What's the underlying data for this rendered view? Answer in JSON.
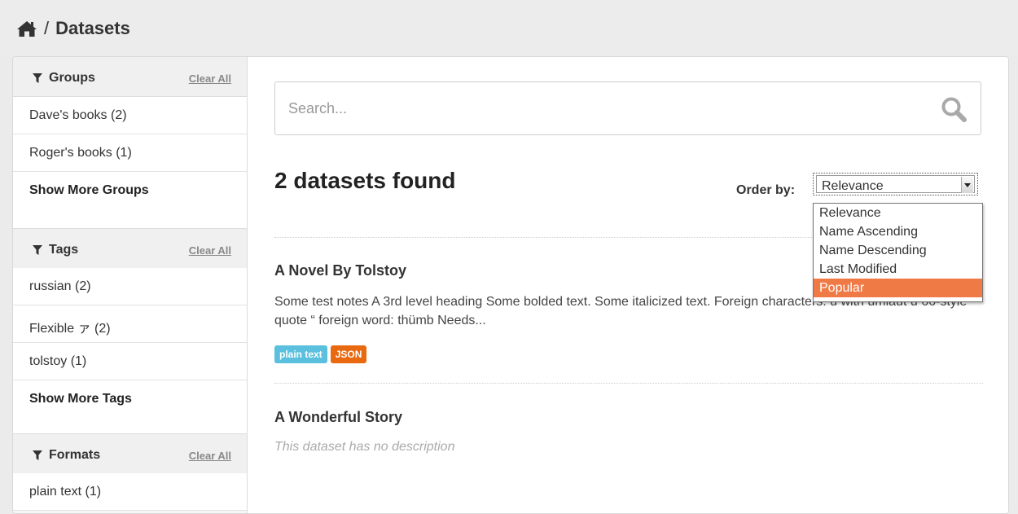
{
  "breadcrumb": {
    "home_icon": "home-icon",
    "separator": "/",
    "current": "Datasets"
  },
  "sidebar": {
    "groups": {
      "title": "Groups",
      "clear_all": "Clear All",
      "items": [
        "Dave's books (2)",
        "Roger's books (1)"
      ],
      "show_more": "Show More Groups"
    },
    "tags": {
      "title": "Tags",
      "clear_all": "Clear All",
      "items": [
        "russian (2)",
        "Flexible ァ (2)",
        "tolstoy (1)"
      ],
      "show_more": "Show More Tags"
    },
    "formats": {
      "title": "Formats",
      "clear_all": "Clear All",
      "items": [
        "plain text (1)"
      ]
    }
  },
  "search": {
    "placeholder": "Search...",
    "value": ""
  },
  "results": {
    "title": "2 datasets found",
    "order_by_label": "Order by:",
    "order_by_value": "Relevance",
    "order_options": [
      "Relevance",
      "Name Ascending",
      "Name Descending",
      "Last Modified",
      "Popular"
    ],
    "highlighted_option": "Popular"
  },
  "datasets": [
    {
      "title": "A Novel By Tolstoy",
      "notes": "Some test notes A 3rd level heading Some bolded text. Some italicized text. Foreign characters: ü with umlaut ū 66-style quote “ foreign word: thümb Needs...",
      "formats": [
        {
          "label": "plain text",
          "color": "#5bc0de"
        },
        {
          "label": "JSON",
          "color": "#e8690f"
        }
      ]
    },
    {
      "title": "A Wonderful Story",
      "empty_description": "This dataset has no description"
    }
  ],
  "colors": {
    "accent": "#f07a45",
    "plain_text_badge": "#5bc0de",
    "json_badge": "#e8690f"
  }
}
